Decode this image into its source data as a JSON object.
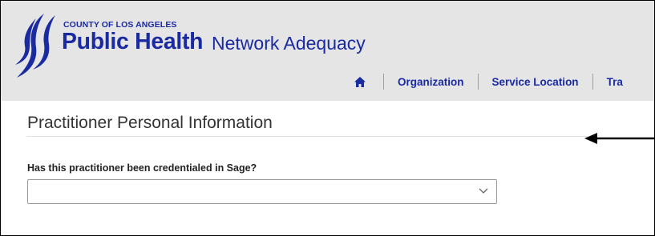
{
  "header": {
    "county": "COUNTY OF LOS ANGELES",
    "brand": "Public Health",
    "app_title": "Network Adequacy",
    "logo_icon": "la-public-health-logo",
    "brand_color": "#1a2aa0",
    "background": "#e5e5e5"
  },
  "nav": {
    "home_icon": "home-icon",
    "items": [
      "Organization",
      "Service Location",
      "Tra"
    ]
  },
  "form": {
    "section_title": "Practitioner Personal Information",
    "credentialed_label": "Has this practitioner been credentialed in Sage?",
    "credentialed_value": "",
    "dropdown_icon": "chevron-down-icon"
  },
  "annotation": {
    "arrow_icon": "arrow-left-icon"
  }
}
